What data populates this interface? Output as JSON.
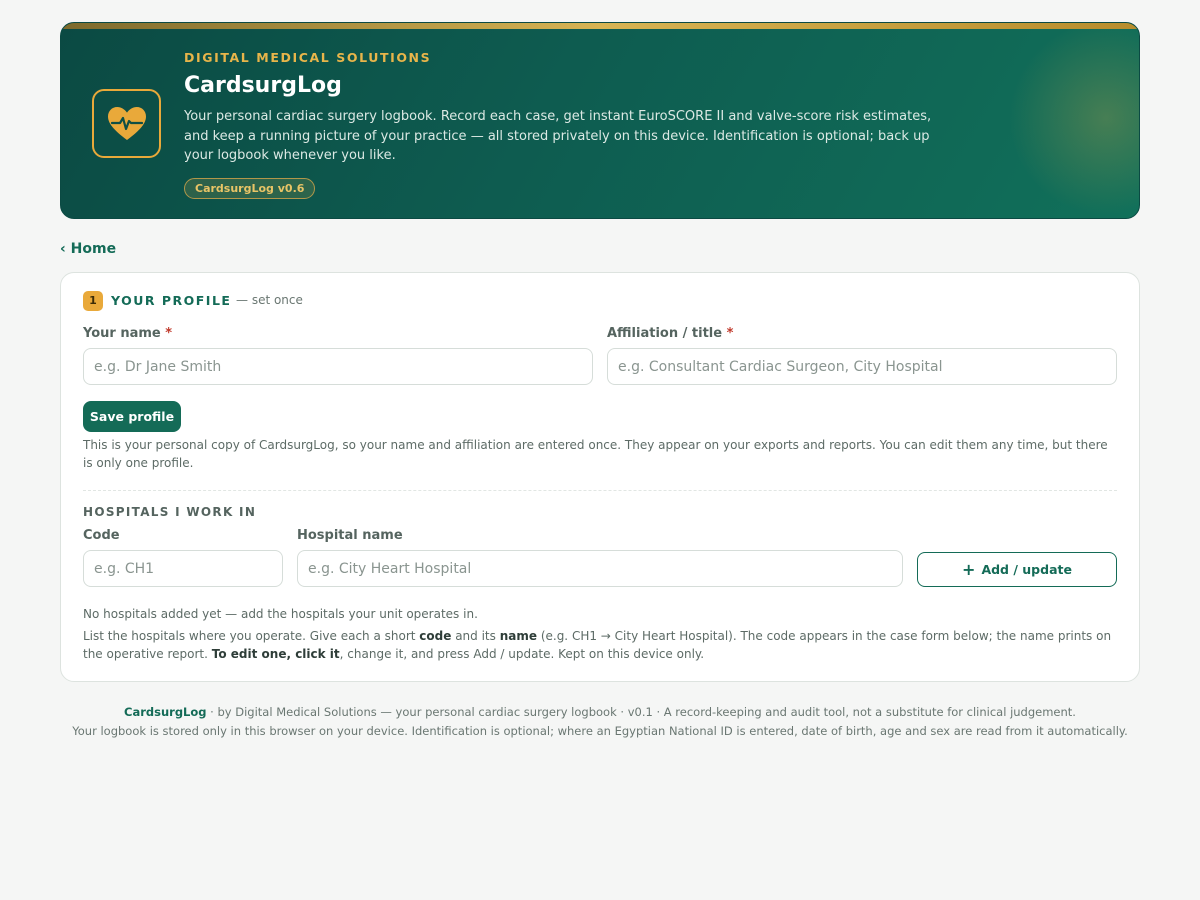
{
  "header": {
    "brand": "DIGITAL MEDICAL SOLUTIONS",
    "title": "CardsurgLog",
    "description": "Your personal cardiac surgery logbook. Record each case, get instant EuroSCORE II and valve-score risk estimates, and keep a running picture of your practice — all stored privately on this device. Identification is optional; back up your logbook whenever you like.",
    "version": "CardsurgLog v0.6",
    "logo_icon": "heart-pulse-icon",
    "accent_color": "#e9a93a"
  },
  "nav": {
    "home_label": "‹ Home"
  },
  "profile": {
    "step": "1",
    "title": "YOUR PROFILE",
    "note": "— set once",
    "name_label": "Your name",
    "name_placeholder": "e.g. Dr Jane Smith",
    "name_value": "",
    "affiliation_label": "Affiliation / title",
    "affiliation_placeholder": "e.g. Consultant Cardiac Surgeon, City Hospital",
    "affiliation_value": "",
    "required_mark": "*",
    "save_label": "Save profile",
    "help": "This is your personal copy of CardsurgLog, so your name and affiliation are entered once. They appear on your exports and reports. You can edit them any time, but there is only one profile."
  },
  "hospitals": {
    "title": "HOSPITALS I WORK IN",
    "code_label": "Code",
    "code_placeholder": "e.g. CH1",
    "code_value": "",
    "name_label": "Hospital name",
    "name_placeholder": "e.g. City Heart Hospital",
    "name_value": "",
    "add_icon": "plus-icon",
    "add_label": "Add / update",
    "empty_text": "No hospitals added yet — add the hospitals your unit operates in.",
    "help_1": "List the hospitals where you operate. Give each a short ",
    "help_code": "code",
    "help_2": " and its ",
    "help_name": "name",
    "help_3": " (e.g. CH1 → City Heart Hospital). The code appears in the case form below; the name prints on the operative report. ",
    "help_edit": "To edit one, click it",
    "help_4": ", change it, and press Add / update. Kept on this device only."
  },
  "footer": {
    "brand": "CardsurgLog",
    "line1": " · by Digital Medical Solutions — your personal cardiac surgery logbook · v0.1 · A record-keeping and audit tool, not a substitute for clinical judgement.",
    "line2": "Your logbook is stored only in this browser on your device. Identification is optional; where an Egyptian National ID is entered, date of birth, age and sex are read from it automatically."
  },
  "colors": {
    "primary": "#146b57",
    "hero_bg": "#0e5c50",
    "accent": "#e9a93a",
    "required": "#c0392b"
  }
}
